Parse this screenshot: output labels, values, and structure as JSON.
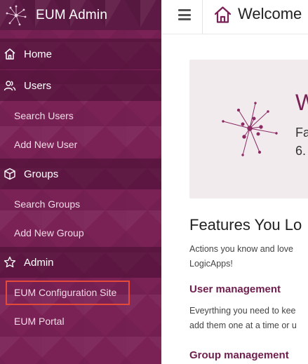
{
  "brand": {
    "title": "EUM Admin"
  },
  "sidebar": {
    "items": [
      {
        "type": "section",
        "label": "Home",
        "icon": "home-icon"
      },
      {
        "type": "section",
        "label": "Users",
        "icon": "users-icon"
      },
      {
        "type": "sub",
        "label": "Search Users"
      },
      {
        "type": "sub",
        "label": "Add New User"
      },
      {
        "type": "section",
        "label": "Groups",
        "icon": "cube-icon"
      },
      {
        "type": "sub",
        "label": "Search Groups"
      },
      {
        "type": "sub",
        "label": "Add New Group"
      },
      {
        "type": "section",
        "label": "Admin",
        "icon": "star-icon"
      },
      {
        "type": "sub",
        "label": "EUM Configuration Site",
        "highlighted": true
      },
      {
        "type": "sub",
        "label": "EUM Portal"
      }
    ]
  },
  "topbar": {
    "title": "Welcome"
  },
  "hero": {
    "heading": "W",
    "line1": "Fa",
    "line2": "6."
  },
  "features": {
    "title": "Features You Lo",
    "desc_line1": "Actions you know and love",
    "desc_line2": "LogicApps!",
    "user_mgmt_heading": "User management",
    "user_mgmt_line1": "Eveyrthing you need to kee",
    "user_mgmt_line2": "add them one at a time or u",
    "group_mgmt_heading": "Group management"
  },
  "colors": {
    "sidebar": "#7a2155",
    "accent": "#7a2155",
    "highlight_box": "#e5493a"
  }
}
